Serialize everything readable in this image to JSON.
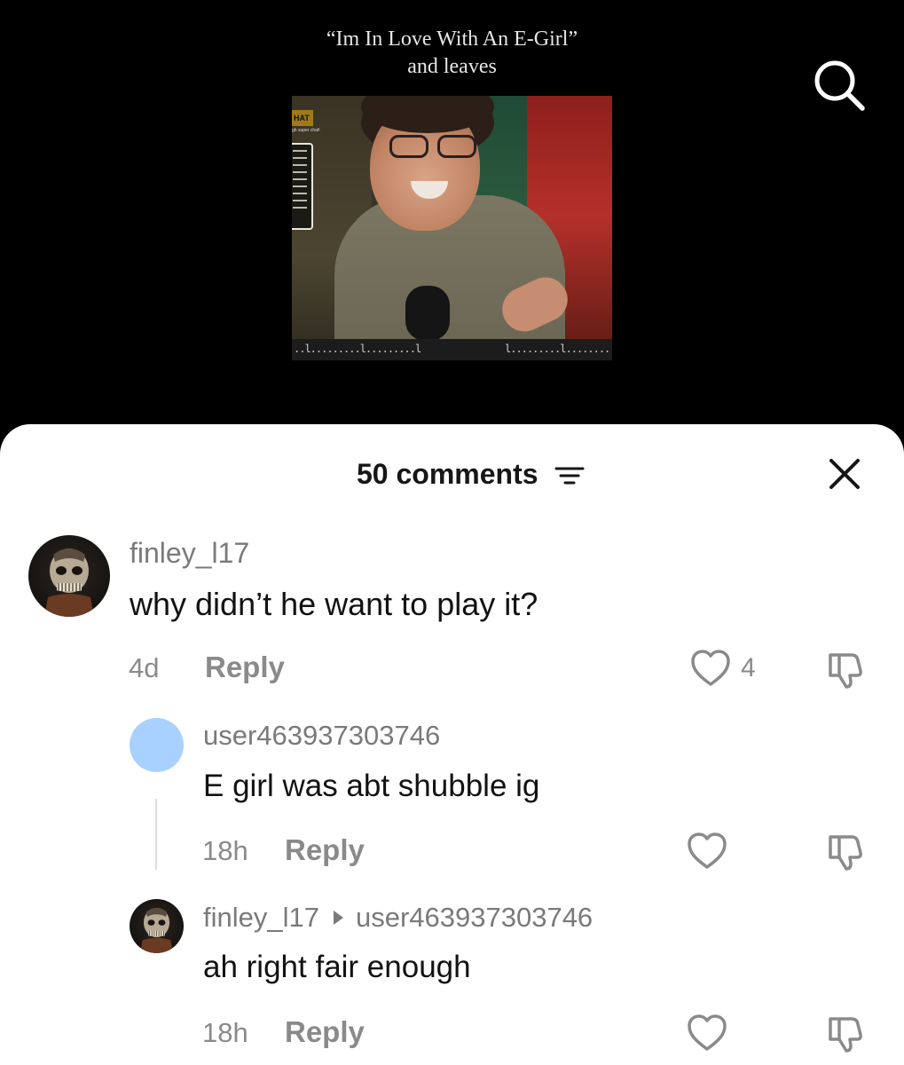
{
  "video": {
    "caption_line1": "“Im In Love With An E-Girl”",
    "caption_line2": "and leaves",
    "search_icon": "search-icon",
    "frame": {
      "chat_tab": "HAT",
      "chat_sub": "gh super chat!"
    }
  },
  "sheet": {
    "comments_count": "50 comments",
    "sort_icon": "sort-icon",
    "close_icon": "close-icon"
  },
  "comments": [
    {
      "username": "finley_l17",
      "text": "why didn’t he want to play it?",
      "time": "4d",
      "reply_label": "Reply",
      "likes": "4",
      "avatar": "skull-avatar"
    },
    {
      "username": "user463937303746",
      "text": "E girl was abt shubble ig",
      "time": "18h",
      "reply_label": "Reply",
      "avatar": "default-avatar"
    },
    {
      "username": "finley_l17",
      "reply_to": "user463937303746",
      "text": "ah right fair enough",
      "time": "18h",
      "reply_label": "Reply",
      "avatar": "skull-avatar"
    }
  ],
  "colors": {
    "sheet_background": "#ffffff",
    "page_background": "#000000",
    "muted_text": "#8a8a8a",
    "primary_text": "#121212",
    "default_avatar": "#a9d1ff"
  }
}
